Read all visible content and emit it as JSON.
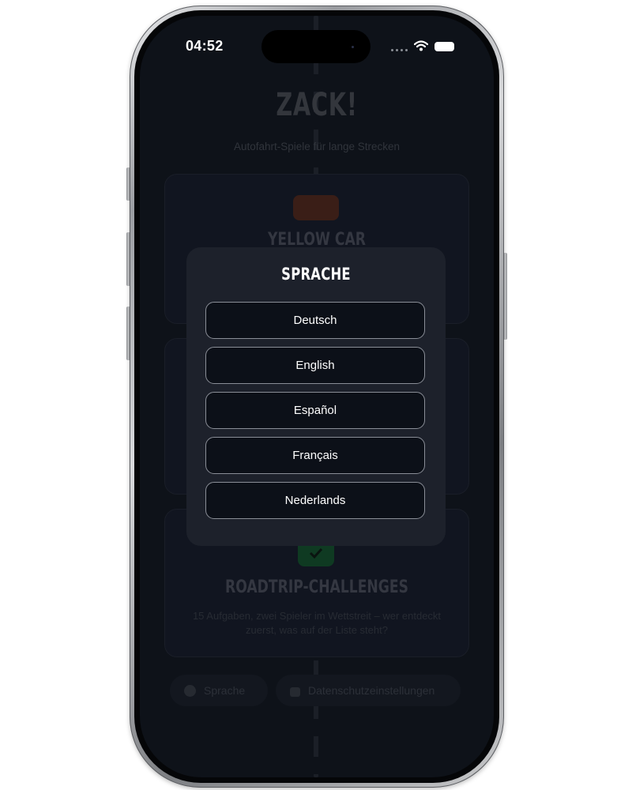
{
  "status_bar": {
    "time": "04:52",
    "icons": [
      "signal-dots-icon",
      "wifi-icon",
      "battery-icon"
    ]
  },
  "app": {
    "title": "ZACK!",
    "subtitle": "Autofahrt-Spiele für lange Strecken",
    "cards": [
      {
        "title": "YELLOW CAR",
        "description": "",
        "icon": "car-icon",
        "icon_color": "#3a1e17"
      },
      {
        "title": "",
        "description": "",
        "icon": "",
        "icon_color": ""
      },
      {
        "title": "ROADTRIP-CHALLENGES",
        "description": "15 Aufgaben, zwei Spieler im Wettstreit – wer entdeckt zuerst, was auf der Liste steht?",
        "icon": "checkmark-icon",
        "icon_color": "#0f3a22"
      }
    ],
    "footer": {
      "language_label": "Sprache",
      "privacy_label": "Datenschutzeinstellungen"
    }
  },
  "modal": {
    "title": "SPRACHE",
    "languages": [
      "Deutsch",
      "English",
      "Español",
      "Français",
      "Nederlands"
    ]
  },
  "colors": {
    "background": "#0e1219",
    "modal_background": "#1d212b",
    "button_background": "#0c1018",
    "button_border": "#8a8e97",
    "text": "#ffffff"
  }
}
